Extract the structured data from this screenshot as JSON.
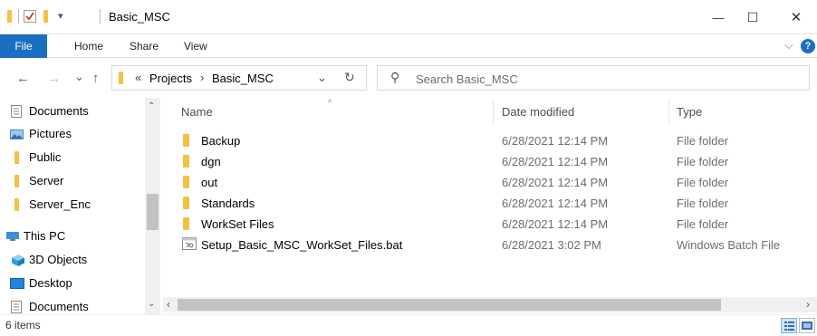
{
  "window": {
    "title": "Basic_MSC",
    "minimize_glyph": "—",
    "maximize_glyph": "☐",
    "close_glyph": "✕",
    "qa_dropdown_glyph": "▾"
  },
  "ribbon": {
    "tabs": [
      "File",
      "Home",
      "Share",
      "View"
    ],
    "expand_glyph": "⌵",
    "help_glyph": "?"
  },
  "nav": {
    "back_glyph": "←",
    "forward_glyph": "→",
    "recent_glyph": "⌄",
    "up_glyph": "↑",
    "breadcrumb_overflow": "«",
    "breadcrumb": [
      "Projects",
      "Basic_MSC"
    ],
    "breadcrumb_sep": "›",
    "dropdown_glyph": "⌄",
    "refresh_glyph": "↻"
  },
  "search": {
    "placeholder": "Search Basic_MSC",
    "icon_glyph": "⚲"
  },
  "sidebar": {
    "items": [
      {
        "label": "Documents",
        "icon": "documents-icon"
      },
      {
        "label": "Pictures",
        "icon": "pictures-icon"
      },
      {
        "label": "Public",
        "icon": "folder-icon"
      },
      {
        "label": "Server",
        "icon": "folder-icon"
      },
      {
        "label": "Server_Enc",
        "icon": "folder-icon"
      },
      {
        "label": "This PC",
        "icon": "computer-icon"
      },
      {
        "label": "3D Objects",
        "icon": "3d-objects-icon"
      },
      {
        "label": "Desktop",
        "icon": "desktop-icon"
      },
      {
        "label": "Documents",
        "icon": "documents-icon"
      }
    ],
    "scroll_up_glyph": "⌃",
    "scroll_down_glyph": "⌄"
  },
  "columns": {
    "name": "Name",
    "date": "Date modified",
    "type": "Type",
    "sort_caret": "^"
  },
  "files": [
    {
      "name": "Backup",
      "date": "6/28/2021 12:14 PM",
      "type": "File folder",
      "icon": "folder-icon"
    },
    {
      "name": "dgn",
      "date": "6/28/2021 12:14 PM",
      "type": "File folder",
      "icon": "folder-icon"
    },
    {
      "name": "out",
      "date": "6/28/2021 12:14 PM",
      "type": "File folder",
      "icon": "folder-icon"
    },
    {
      "name": "Standards",
      "date": "6/28/2021 12:14 PM",
      "type": "File folder",
      "icon": "folder-icon"
    },
    {
      "name": "WorkSet Files",
      "date": "6/28/2021 12:14 PM",
      "type": "File folder",
      "icon": "folder-icon"
    },
    {
      "name": "Setup_Basic_MSC_WorkSet_Files.bat",
      "date": "6/28/2021 3:02 PM",
      "type": "Windows Batch File",
      "icon": "batch-file-icon"
    }
  ],
  "hscroll": {
    "left_glyph": "‹",
    "right_glyph": "›"
  },
  "status": {
    "item_count": "6 items"
  },
  "colors": {
    "file_tab": "#1a6fc4",
    "folder": "#f7c95d",
    "help": "#1a6fc4"
  }
}
